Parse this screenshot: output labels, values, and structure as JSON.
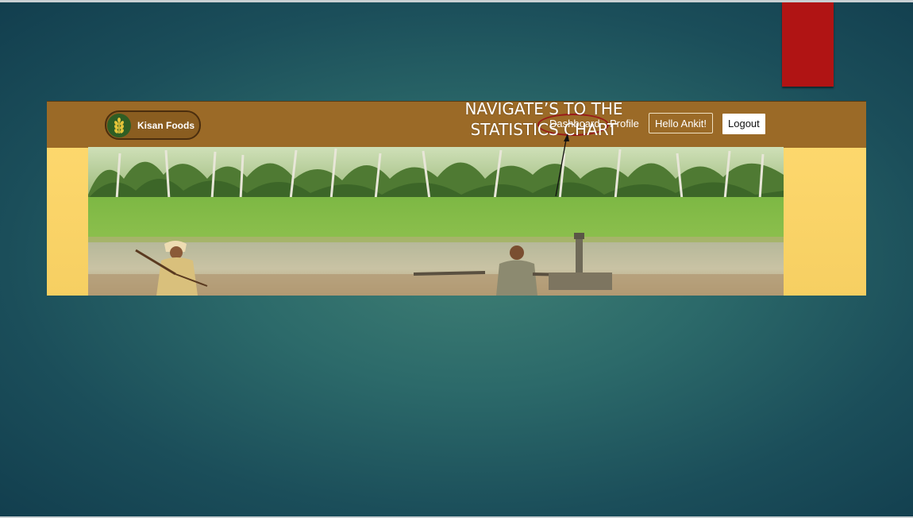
{
  "app": {
    "brand_name": "Kisan Foods",
    "logo_icon": "wheat-icon"
  },
  "nav": {
    "dashboard_label": "Dashboard",
    "profile_label": "Profile",
    "greeting_label": "Hello Ankit!",
    "logout_label": "Logout"
  },
  "annotation": {
    "callout_line1": "NAVIGATE’S TO THE",
    "callout_line2": "STATISTICS CHART"
  },
  "colors": {
    "navbar": "#9b6a27",
    "highlight": "#9a1a1a",
    "accent_tab": "#b01414",
    "page_background": "#ffda70"
  },
  "hero": {
    "icon": "farm-field-image"
  }
}
